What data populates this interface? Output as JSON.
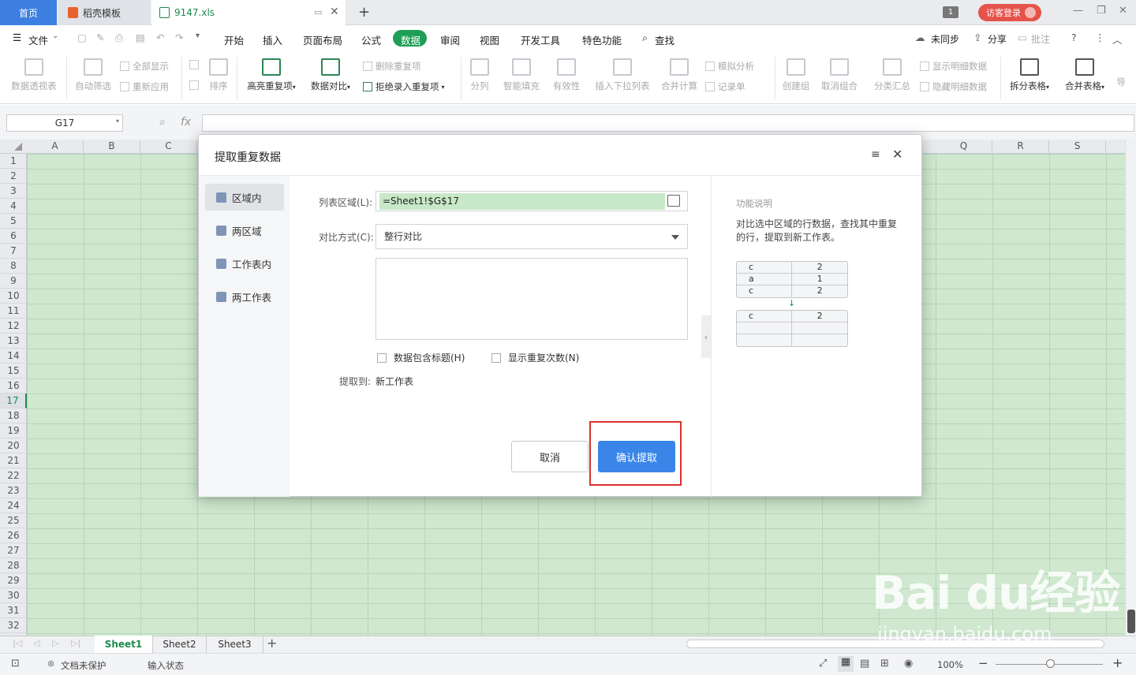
{
  "titlebar": {
    "tabs": [
      {
        "label": "首页"
      },
      {
        "label": "稻壳模板"
      },
      {
        "label": "9147.xls"
      }
    ],
    "new_tab": "+",
    "window_count": "1",
    "visitor_login": "访客登录"
  },
  "menubar": {
    "file": "文件",
    "items": [
      "开始",
      "插入",
      "页面布局",
      "公式",
      "数据",
      "审阅",
      "视图",
      "开发工具",
      "特色功能"
    ],
    "search": "查找",
    "sync": "未同步",
    "share": "分享",
    "comment": "批注",
    "help": "?"
  },
  "ribbon": {
    "pivot": "数据透视表",
    "auto_filter": "自动筛选",
    "show_all": "全部显示",
    "reapply": "重新应用",
    "sort": "排序",
    "highlight_dup": "高亮重复项",
    "data_compare": "数据对比",
    "delete_dup": "删除重复项",
    "reject_dup": "拒绝录入重复项",
    "split_col": "分列",
    "smart_fill": "智能填充",
    "validity": "有效性",
    "insert_dropdown": "插入下拉列表",
    "merge_calc": "合并计算",
    "simulate": "模拟分析",
    "record_form": "记录单",
    "create_group": "创建组",
    "ungroup": "取消组合",
    "subtotal": "分类汇总",
    "show_detail": "显示明细数据",
    "hide_detail": "隐藏明细数据",
    "split_table": "拆分表格",
    "merge_table": "合并表格",
    "more": "导"
  },
  "formula_bar": {
    "cell_ref": "G17",
    "fx": "fx"
  },
  "grid": {
    "cols_left": [
      "A",
      "B",
      "C"
    ],
    "cols_right": [
      "Q",
      "R",
      "S"
    ],
    "rows": [
      "1",
      "2",
      "3",
      "4",
      "5",
      "6",
      "7",
      "8",
      "9",
      "10",
      "11",
      "12",
      "13",
      "14",
      "15",
      "16",
      "17",
      "18",
      "19",
      "20",
      "21",
      "22",
      "23",
      "24",
      "25",
      "26",
      "27",
      "28",
      "29",
      "30",
      "31",
      "32"
    ],
    "selected_row": "17"
  },
  "dialog": {
    "title": "提取重复数据",
    "nav": [
      "区域内",
      "两区域",
      "工作表内",
      "两工作表"
    ],
    "range_label": "列表区域(L):",
    "range_value": "=Sheet1!$G$17",
    "mode_label": "对比方式(C):",
    "mode_value": "整行对比",
    "chk_header": "数据包含标题(H)",
    "chk_count": "显示重复次数(N)",
    "extract_to_label": "提取到:",
    "extract_to_value": "新工作表",
    "cancel": "取消",
    "confirm": "确认提取",
    "side_title": "功能说明",
    "side_desc": "对比选中区域的行数据，查找其中重复的行，提取到新工作表。",
    "example_before": [
      [
        "c",
        "2"
      ],
      [
        "a",
        "1"
      ],
      [
        "c",
        "2"
      ]
    ],
    "example_after": [
      [
        "c",
        "2"
      ],
      [
        "",
        ""
      ],
      [
        "",
        ""
      ]
    ],
    "arrow": "↓"
  },
  "sheet_tabs": [
    "Sheet1",
    "Sheet2",
    "Sheet3"
  ],
  "add_sheet": "+",
  "statusbar": {
    "protect": "文档未保护",
    "input_state": "输入状态",
    "zoom": "100%"
  },
  "watermark": {
    "brand": "Bai du经验",
    "url": "jingyan.baidu.com"
  },
  "colors": {
    "accent": "#1f9e57",
    "primary_button": "#3a86e8",
    "highlight_box": "#d9312c",
    "grid_fill": "#cfe8cf"
  }
}
